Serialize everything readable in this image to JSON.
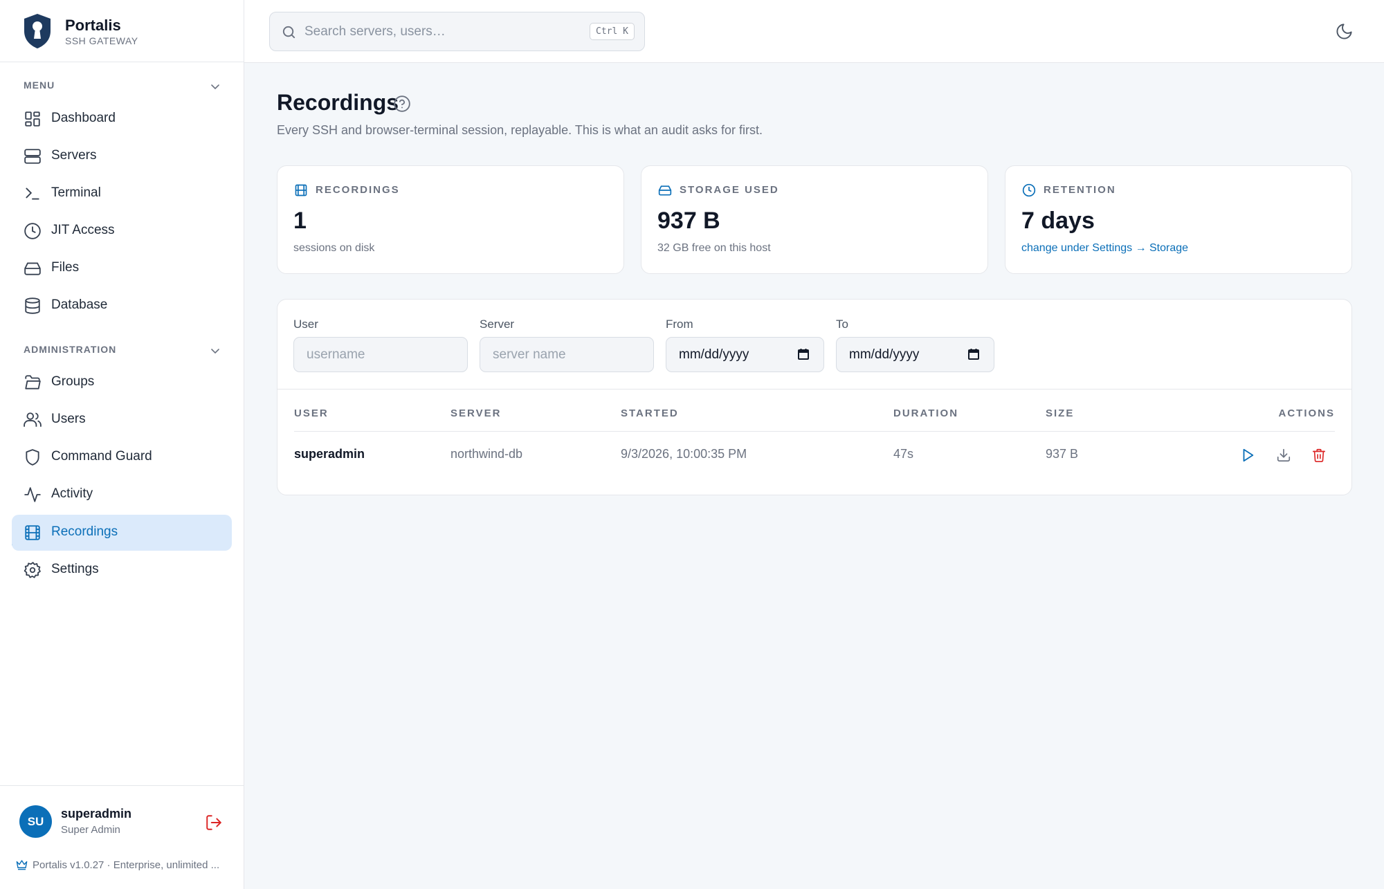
{
  "brand": {
    "name": "Portalis",
    "subtitle": "SSH GATEWAY"
  },
  "sidebar": {
    "menu_heading": "MENU",
    "admin_heading": "ADMINISTRATION",
    "menu_items": [
      {
        "label": "Dashboard",
        "icon": "dashboard-icon"
      },
      {
        "label": "Servers",
        "icon": "servers-icon"
      },
      {
        "label": "Terminal",
        "icon": "terminal-icon"
      },
      {
        "label": "JIT Access",
        "icon": "clock-icon"
      },
      {
        "label": "Files",
        "icon": "drive-icon"
      },
      {
        "label": "Database",
        "icon": "database-icon"
      }
    ],
    "admin_items": [
      {
        "label": "Groups",
        "icon": "folder-icon"
      },
      {
        "label": "Users",
        "icon": "users-icon"
      },
      {
        "label": "Command Guard",
        "icon": "shield-icon"
      },
      {
        "label": "Activity",
        "icon": "activity-icon"
      },
      {
        "label": "Recordings",
        "icon": "film-icon",
        "active": true
      },
      {
        "label": "Settings",
        "icon": "gear-icon"
      }
    ]
  },
  "user": {
    "initials": "SU",
    "name": "superadmin",
    "role": "Super Admin"
  },
  "footer": {
    "version": "Portalis v1.0.27 · Enterprise, unlimited ..."
  },
  "search": {
    "placeholder": "Search servers, users…",
    "shortcut": "Ctrl K"
  },
  "page": {
    "title": "Recordings",
    "description": "Every SSH and browser-terminal session, replayable. This is what an audit asks for first."
  },
  "stats": [
    {
      "label": "RECORDINGS",
      "value": "1",
      "sub": "sessions on disk",
      "icon": "film-icon"
    },
    {
      "label": "STORAGE USED",
      "value": "937 B",
      "sub": "32 GB free on this host",
      "icon": "drive-icon"
    },
    {
      "label": "RETENTION",
      "value": "7 days",
      "sub": "change under Settings → Storage",
      "icon": "clock-icon"
    }
  ],
  "filters": {
    "user_label": "User",
    "user_placeholder": "username",
    "server_label": "Server",
    "server_placeholder": "server name",
    "from_label": "From",
    "from_value": "mm/dd/yyyy",
    "to_label": "To",
    "to_value": "mm/dd/yyyy"
  },
  "table": {
    "headers": [
      "USER",
      "SERVER",
      "STARTED",
      "DURATION",
      "SIZE",
      "ACTIONS"
    ],
    "rows": [
      {
        "user": "superadmin",
        "server": "northwind-db",
        "started": "9/3/2026, 10:00:35 PM",
        "duration": "47s",
        "size": "937 B"
      }
    ]
  },
  "colors": {
    "accent": "#0b6fb8",
    "danger": "#dc2626",
    "active_bg": "#dbeafb"
  }
}
